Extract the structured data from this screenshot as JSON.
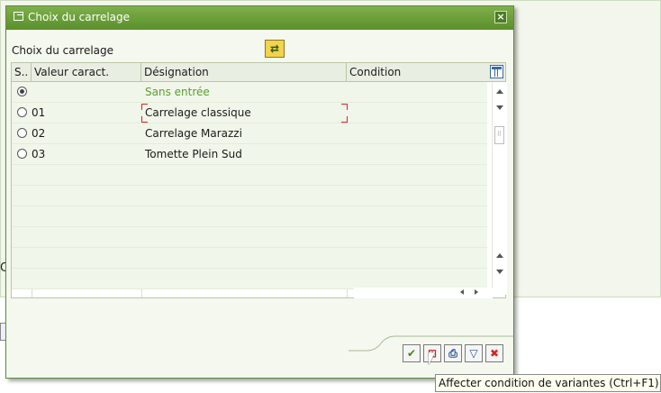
{
  "dialog": {
    "title": "Choix du carrelage",
    "table_title": "Choix du carrelage",
    "close_label": "×"
  },
  "table": {
    "columns": [
      "S..",
      "Valeur caract.",
      "Désignation",
      "Condition"
    ],
    "rows": [
      {
        "selected": true,
        "value": "",
        "designation": "Sans entrée",
        "condition": ""
      },
      {
        "selected": false,
        "value": "01",
        "designation": "Carrelage classique",
        "condition": ""
      },
      {
        "selected": false,
        "value": "02",
        "designation": "Carrelage Marazzi",
        "condition": ""
      },
      {
        "selected": false,
        "value": "03",
        "designation": "Tomette Plein Sud",
        "condition": ""
      }
    ]
  },
  "toolbar": {
    "buttons": [
      {
        "name": "confirm-button",
        "icon": "checkmark-icon",
        "glyph": "✔",
        "color": "#3f8a14"
      },
      {
        "name": "assign-variant-condition-button",
        "icon": "variant-condition-icon",
        "glyph": "⊞",
        "color": "#c0302a"
      },
      {
        "name": "print-button",
        "icon": "printer-icon",
        "glyph": "⎙",
        "color": "#1f4f9a"
      },
      {
        "name": "filter-button",
        "icon": "filter-icon",
        "glyph": "▽",
        "color": "#1f4f9a"
      },
      {
        "name": "cancel-button",
        "icon": "cancel-icon",
        "glyph": "✖",
        "color": "#d3251c"
      }
    ]
  },
  "tooltip": {
    "text": "Affecter condition de variantes   (Ctrl+F1)"
  },
  "background": {
    "fragment_text": "C"
  },
  "colors": {
    "title_bar": "#6aa03a",
    "default_entry_text": "#5aa02c",
    "dialog_bg": "#f4f8ef"
  }
}
